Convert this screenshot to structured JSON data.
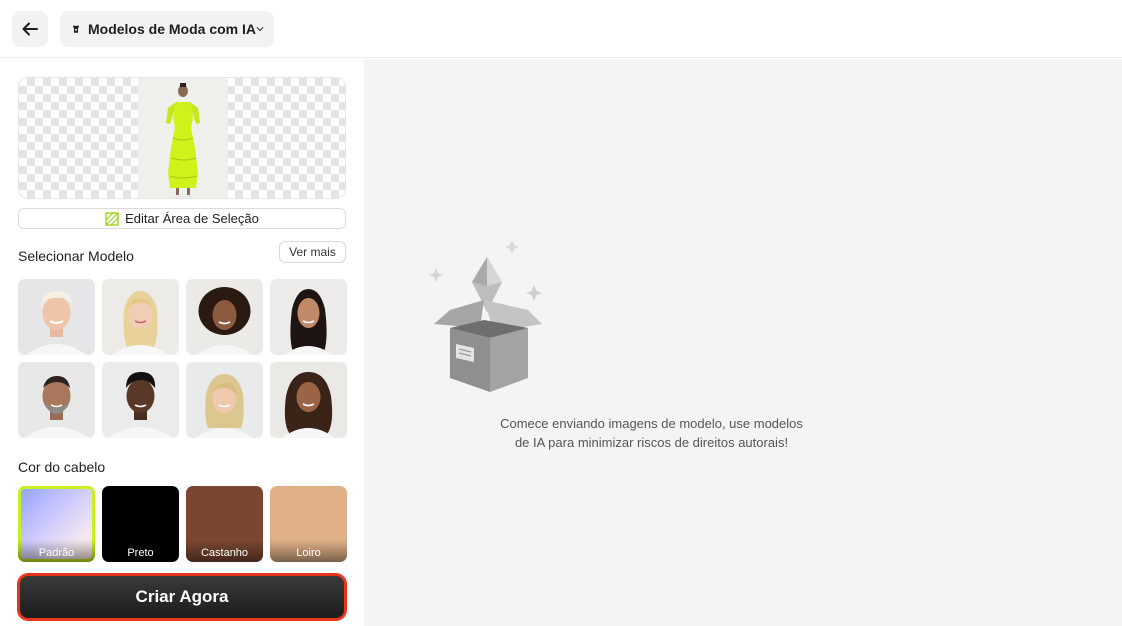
{
  "topbar": {
    "back_icon": "arrow-left-icon",
    "tool_icon": "fashion-model-icon",
    "tool_title": "Modelos de Moda com IA",
    "dropdown_icon": "chevron-down-icon"
  },
  "left_panel": {
    "edit_selection_label": "Editar Área de Seleção",
    "select_model_title": "Selecionar Modelo",
    "see_more_label": "Ver mais",
    "models": [
      {
        "id": "blond-man"
      },
      {
        "id": "blond-woman"
      },
      {
        "id": "curly-woman"
      },
      {
        "id": "dark-hair-woman"
      },
      {
        "id": "bearded-man"
      },
      {
        "id": "black-man"
      },
      {
        "id": "blonde-woman-2"
      },
      {
        "id": "curly-woman-2"
      }
    ],
    "hair_color_title": "Cor do cabelo",
    "hair_colors": [
      {
        "label": "Padrão",
        "color": "#c9c6ff",
        "selected": true
      },
      {
        "label": "Preto",
        "color": "#000000",
        "selected": false
      },
      {
        "label": "Castanho",
        "color": "#7a4631",
        "selected": false
      },
      {
        "label": "Loiro",
        "color": "#e0b088",
        "selected": false
      }
    ],
    "create_label": "Criar Agora"
  },
  "empty_state": {
    "icon": "empty-box-icon",
    "line1": "Comece enviando imagens de modelo, use modelos",
    "line2": "de IA para minimizar riscos de direitos autorais!"
  },
  "colors": {
    "accent_lime": "#c7f21f",
    "create_border": "#e8341c",
    "panel_bg": "#f4f4f4"
  }
}
